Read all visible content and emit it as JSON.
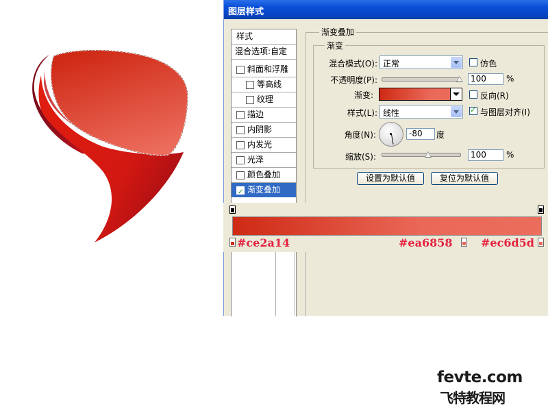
{
  "dialog": {
    "title": "图层样式",
    "styles_header": "样式",
    "blend_options": "混合选项:自定",
    "style_items": [
      {
        "label": "斜面和浮雕",
        "checked": false,
        "sub": false
      },
      {
        "label": "等高线",
        "checked": false,
        "sub": true
      },
      {
        "label": "纹理",
        "checked": false,
        "sub": true
      },
      {
        "label": "描边",
        "checked": false,
        "sub": false
      },
      {
        "label": "内阴影",
        "checked": false,
        "sub": false
      },
      {
        "label": "内发光",
        "checked": false,
        "sub": false
      },
      {
        "label": "光泽",
        "checked": false,
        "sub": false
      },
      {
        "label": "颜色叠加",
        "checked": false,
        "sub": false
      },
      {
        "label": "渐变叠加",
        "checked": true,
        "sub": false,
        "active": true
      }
    ]
  },
  "gradient_overlay": {
    "section_title": "渐变叠加",
    "group_title": "渐变",
    "blend_mode_label": "混合模式(O):",
    "blend_mode_value": "正常",
    "dither_label": "仿色",
    "dither_checked": false,
    "opacity_label": "不透明度(P):",
    "opacity_value": "100",
    "opacity_unit": "%",
    "gradient_label": "渐变:",
    "reverse_label": "反向(R)",
    "reverse_checked": false,
    "style_label": "样式(L):",
    "style_value": "线性",
    "align_label": "与图层对齐(I)",
    "align_checked": true,
    "angle_label": "角度(N):",
    "angle_value": "-80",
    "angle_unit": "度",
    "scale_label": "缩放(S):",
    "scale_value": "100",
    "scale_unit": "%",
    "opacity_fraction": 1.0,
    "scale_fraction": 0.6,
    "set_default_button": "设置为默认值",
    "reset_default_button": "复位为默认值"
  },
  "gradient_editor": {
    "stops": [
      {
        "label": "#ce2a14",
        "color": "#ce2a14",
        "location": 0
      },
      {
        "label": "#ea6858",
        "color": "#ea6858",
        "location": 0.75
      },
      {
        "label": "#ec6d5d",
        "color": "#ec6d5d",
        "location": 1
      }
    ]
  },
  "watermark": {
    "line1": "fevte.com",
    "line2": "飞特教程网"
  },
  "colors": {
    "titlebar": "#0a50d8",
    "dialog_bg": "#ECE9D8",
    "active_item": "#316AC5",
    "annotation": "#e5213e"
  }
}
